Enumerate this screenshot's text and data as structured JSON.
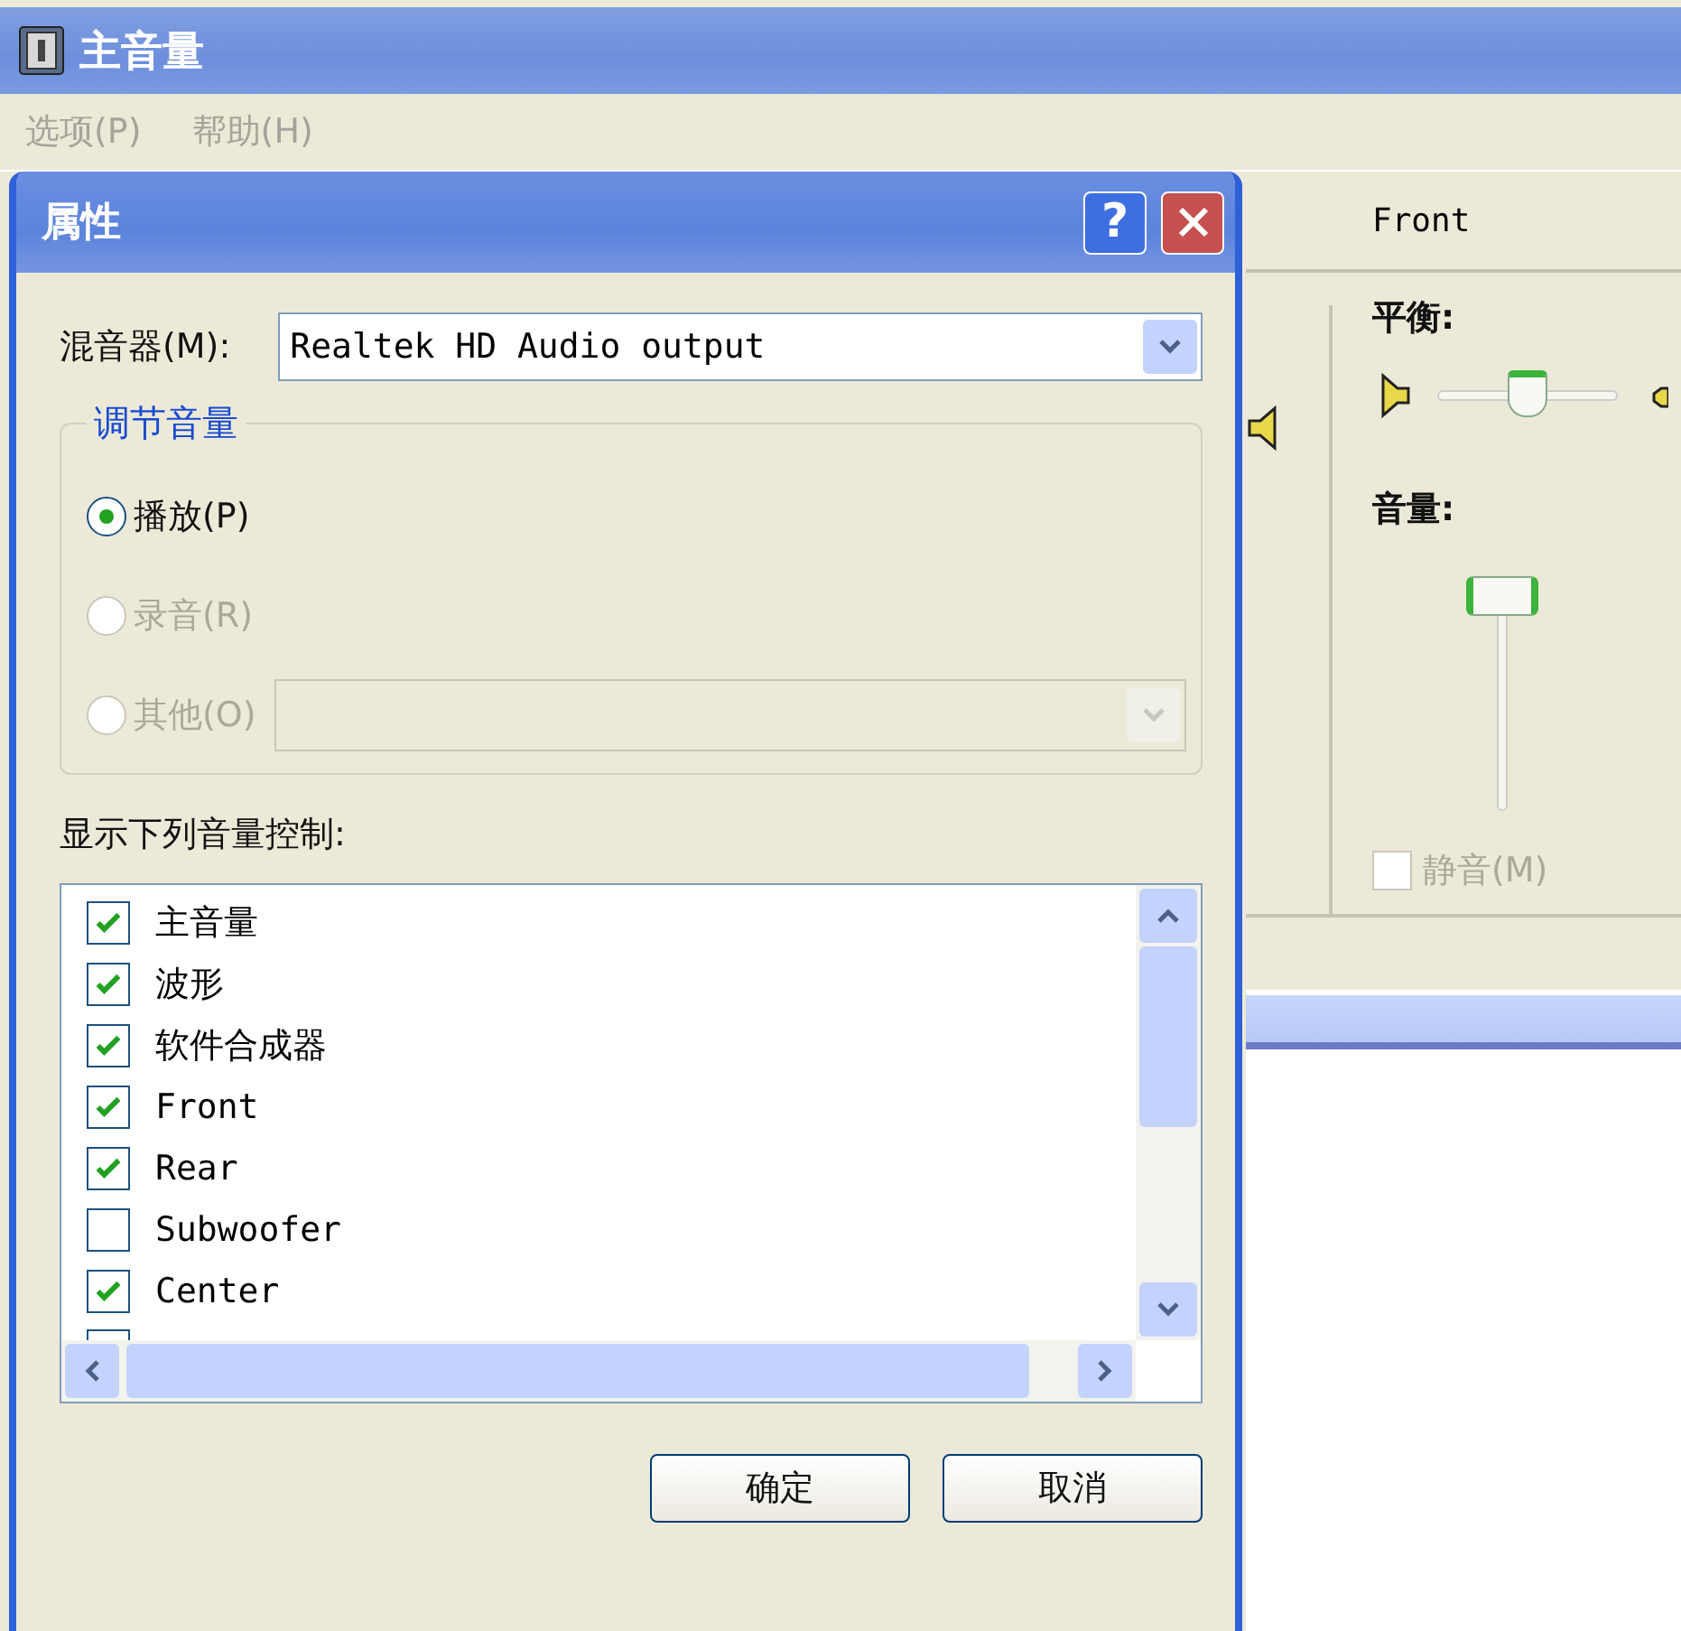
{
  "window": {
    "title": "主音量"
  },
  "menu": [
    {
      "label": "选项(P)",
      "disabled": true
    },
    {
      "label": "帮助(H)",
      "disabled": true
    }
  ],
  "channel": {
    "name": "Front",
    "balance_label": "平衡:",
    "balance": {
      "level": 0.5
    },
    "volume_label": "音量:",
    "volume": {
      "level": 1.0
    },
    "mute": {
      "label": "静音(M)",
      "checked": false,
      "disabled": true
    }
  },
  "dialog": {
    "title": "属性",
    "help_button": "?",
    "mixer": {
      "label": "混音器(M):",
      "value": "Realtek HD Audio output"
    },
    "group": {
      "title": "调节音量",
      "options": [
        {
          "label": "播放(P)",
          "selected": true,
          "disabled": false
        },
        {
          "label": "录音(R)",
          "selected": false,
          "disabled": true
        },
        {
          "label": "其他(O)",
          "selected": false,
          "disabled": true
        }
      ],
      "other_dropdown": {
        "disabled": true
      }
    },
    "list_label": "显示下列音量控制:",
    "controls": [
      {
        "label": "主音量",
        "checked": true
      },
      {
        "label": "波形",
        "checked": true
      },
      {
        "label": "软件合成器",
        "checked": true
      },
      {
        "label": "Front",
        "checked": true
      },
      {
        "label": "Rear",
        "checked": true
      },
      {
        "label": "Subwoofer",
        "checked": false
      },
      {
        "label": "Center",
        "checked": true
      }
    ],
    "buttons": [
      "确定",
      "取消"
    ]
  }
}
